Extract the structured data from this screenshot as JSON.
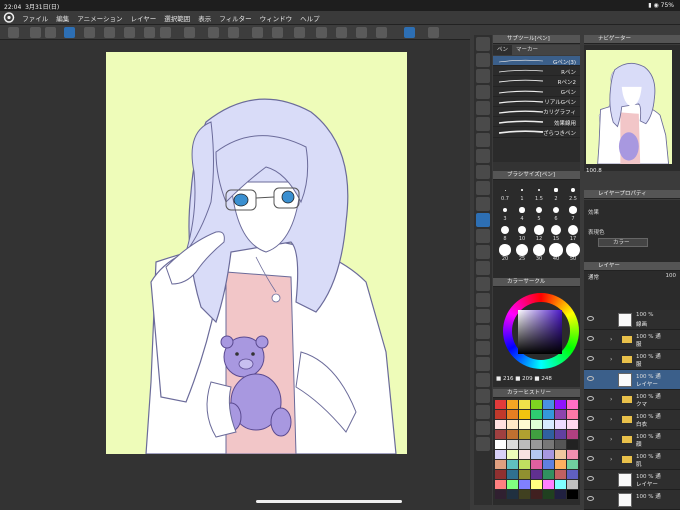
{
  "status": {
    "time": "22:04",
    "date": "3月31日(日)",
    "battery": "75%"
  },
  "menu": [
    "ファイル",
    "編集",
    "アニメーション",
    "レイヤー",
    "選択範囲",
    "表示",
    "フィルター",
    "ウィンドウ",
    "ヘルプ"
  ],
  "subtool": {
    "title": "サブツール[ペン]",
    "tabs": [
      "ペン",
      "マーカー"
    ],
    "items": [
      "Gペン(3)",
      "Rペン",
      "Rペン2",
      "Gペン",
      "リアルGペン",
      "カリグラフィ",
      "効果線用",
      "ざらつきペン"
    ],
    "selected_index": 0
  },
  "navigator": {
    "title": "ナビゲーター",
    "zoom": "100.8"
  },
  "brushsize": {
    "title": "ブラシサイズ[ペン]",
    "sizes": [
      "0.7",
      "1",
      "1.5",
      "2",
      "2.5",
      "3",
      "4",
      "5",
      "6",
      "7",
      "8",
      "10",
      "12",
      "15",
      "17",
      "20",
      "25",
      "30",
      "40",
      "50"
    ]
  },
  "colorwheel": {
    "title": "カラーサークル",
    "r": "216",
    "g": "209",
    "b": "248"
  },
  "history": {
    "title": "カラーヒストリー"
  },
  "props": {
    "title": "レイヤープロパティ",
    "effect": "効果",
    "display_color": "表現色",
    "color_mode": "カラー"
  },
  "layers": {
    "title": "レイヤー",
    "blend": "通常",
    "opacity": "100",
    "rows": [
      {
        "pct": "100 %",
        "name": "線画",
        "type": "raster"
      },
      {
        "pct": "100 % 通",
        "name": "服",
        "type": "folder"
      },
      {
        "pct": "100 % 通",
        "name": "服",
        "type": "folder"
      },
      {
        "pct": "100 % 通",
        "name": "レイヤー",
        "type": "raster"
      },
      {
        "pct": "100 % 通",
        "name": "クマ",
        "type": "folder"
      },
      {
        "pct": "100 % 通",
        "name": "白衣",
        "type": "folder"
      },
      {
        "pct": "100 % 通",
        "name": "顔",
        "type": "folder"
      },
      {
        "pct": "100 % 通",
        "name": "肌",
        "type": "folder"
      },
      {
        "pct": "100 % 通",
        "name": "レイヤー",
        "type": "raster"
      },
      {
        "pct": "100 % 通",
        "name": "",
        "type": "raster"
      }
    ],
    "selected_index": 3
  },
  "colors": {
    "canvas_bg": "#eefcb9",
    "hair": "#d9dcf8",
    "bear": "#a898e0",
    "skin": "#ffffff",
    "accent": "#3b5f8a",
    "swatches": [
      "#e23a3a",
      "#f5a623",
      "#f0e24a",
      "#7ed321",
      "#4a90e2",
      "#9013fe",
      "#ff6ec7",
      "#c0392b",
      "#e67e22",
      "#f1c40f",
      "#2ecc71",
      "#3498db",
      "#8e44ad",
      "#fd79a8",
      "#ffe0e0",
      "#ffe9c8",
      "#fffbd1",
      "#e0ffd5",
      "#d9ecff",
      "#eedcff",
      "#ffd9ef",
      "#a04040",
      "#c07030",
      "#b0a030",
      "#40a040",
      "#3060a0",
      "#6040a0",
      "#b04080",
      "#ffffff",
      "#dddddd",
      "#bbbbbb",
      "#999999",
      "#777777",
      "#555555",
      "#222222",
      "#d8d1f8",
      "#eefcb9",
      "#f8e2e2",
      "#b4c8f0",
      "#a898e0",
      "#f0c8a0",
      "#f090b0",
      "#e0a080",
      "#60c0c0",
      "#c0e060",
      "#e060a0",
      "#6080e0",
      "#ffb060",
      "#70d0a0",
      "#903030",
      "#307090",
      "#909030",
      "#603090",
      "#309060",
      "#c06060",
      "#6060c0",
      "#ff8080",
      "#80ff80",
      "#8080ff",
      "#ffff80",
      "#ff80ff",
      "#80ffff",
      "#c0c0c0",
      "#302030",
      "#203040",
      "#404020",
      "#402020",
      "#204020",
      "#202040",
      "#000000"
    ]
  }
}
